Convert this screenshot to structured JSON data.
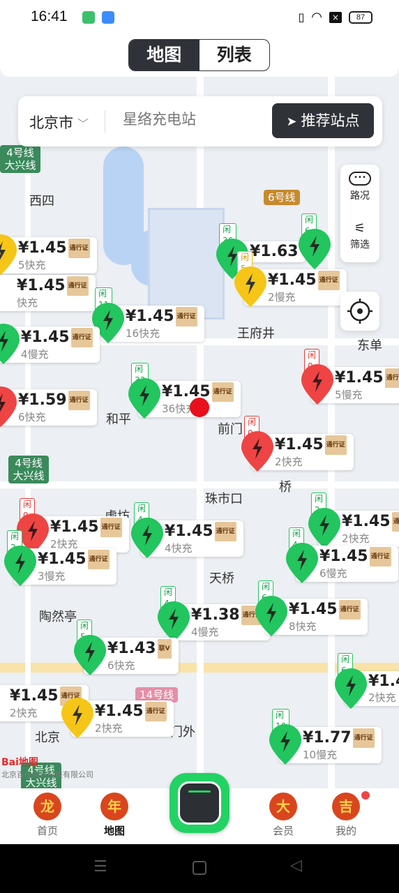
{
  "status": {
    "time": "16:41",
    "battery": "87"
  },
  "tabs": [
    {
      "label": "地图",
      "active": true
    },
    {
      "label": "列表",
      "active": false
    }
  ],
  "search": {
    "city": "北京市",
    "placeholder": "星络充电站",
    "recommend_label": "推荐站点"
  },
  "tools": {
    "traffic_label": "路况",
    "filter_label": "筛选"
  },
  "map": {
    "labels": [
      "西四",
      "王府井",
      "东单",
      "和平",
      "前门",
      "珠市口",
      "虎坊",
      "天桥",
      "陶然亭",
      "门外",
      "桥",
      "北京"
    ],
    "line_badges": [
      "4号线\n大兴线",
      "6号线",
      "4号线\n大兴线",
      "14号线",
      "4号线\n大兴线"
    ],
    "watermark": "北京百度网讯科技有限公司",
    "logo": "Bai地图"
  },
  "stations": [
    {
      "idle": "",
      "price": "¥1.45",
      "sub": "5快充",
      "color": "yellow"
    },
    {
      "idle": "",
      "price": "¥1.45",
      "sub": "快充",
      "color": "green"
    },
    {
      "idle": "闲11",
      "price": "¥1.45",
      "sub": "16快充",
      "color": "green"
    },
    {
      "idle": "",
      "price": "¥1.45",
      "sub": "4慢充",
      "color": "green"
    },
    {
      "idle": "",
      "price": "¥1.59",
      "sub": "6快充",
      "color": "red"
    },
    {
      "idle": "闲33",
      "price": "¥1.45",
      "sub": "36快充",
      "color": "green"
    },
    {
      "idle": "闲36",
      "price": "¥1.63",
      "sub": "",
      "color": "green"
    },
    {
      "idle": "闲5",
      "price": "¥1.45",
      "sub": "2慢充",
      "color": "yellow"
    },
    {
      "idle": "闲6",
      "price": "",
      "sub": "8快充",
      "color": "green"
    },
    {
      "idle": "闲0",
      "price": "¥1.45",
      "sub": "5慢充",
      "color": "red"
    },
    {
      "idle": "闲0",
      "price": "¥1.45",
      "sub": "2快充",
      "color": "red"
    },
    {
      "idle": "闲0",
      "price": "¥1.45",
      "sub": "2快充",
      "color": "red"
    },
    {
      "idle": "闲4",
      "price": "¥1.45",
      "sub": "4快充",
      "color": "green"
    },
    {
      "idle": "闲2",
      "price": "¥1.45",
      "sub": "3慢充",
      "color": "green"
    },
    {
      "idle": "闲2",
      "price": "¥1.45",
      "sub": "2快充",
      "color": "green"
    },
    {
      "idle": "闲4",
      "price": "¥1.45",
      "sub": "6慢充",
      "color": "green"
    },
    {
      "idle": "闲4",
      "price": "¥1.38",
      "sub": "4慢充",
      "color": "green"
    },
    {
      "idle": "闲6",
      "price": "¥1.45",
      "sub": "8快充",
      "color": "green"
    },
    {
      "idle": "闲5",
      "price": "¥1.43",
      "sub": "6快充",
      "color": "green"
    },
    {
      "idle": "",
      "price": "¥1.45",
      "sub": "2快充",
      "color": "white"
    },
    {
      "idle": "",
      "price": "¥1.45",
      "sub": "2快充",
      "color": "yellow"
    },
    {
      "idle": "闲10",
      "price": "¥1.77",
      "sub": "10慢充",
      "color": "green"
    },
    {
      "idle": "闲6",
      "price": "¥1.4",
      "sub": "2快充",
      "color": "green"
    }
  ],
  "tag_text": "通行证",
  "nav": [
    {
      "label": "首页",
      "icon": "龙"
    },
    {
      "label": "地图",
      "icon": "年",
      "active": true
    },
    {
      "label": "会员",
      "icon": "大"
    },
    {
      "label": "我的",
      "icon": "吉"
    }
  ],
  "colors": {
    "green": "#22c55e",
    "red": "#ef4444",
    "yellow": "#f5c518",
    "dark": "#2f3238"
  }
}
